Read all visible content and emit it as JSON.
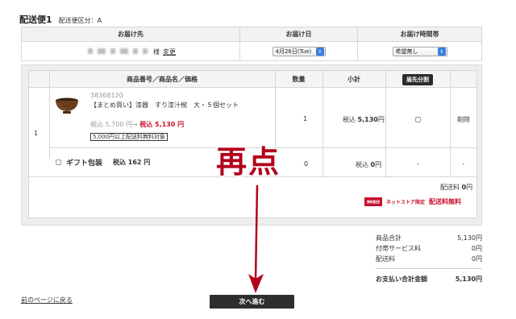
{
  "heading": {
    "title": "配送便1",
    "subtitle": "配送便区分：A"
  },
  "address_table": {
    "col_recipient": "お届け先",
    "col_date": "お届け日",
    "col_time": "お届け時間帯",
    "honorific": "様",
    "change_link": "変更",
    "date_value": "4月26日(Tue)",
    "time_value": "希望無し"
  },
  "items_table": {
    "col_product": "商品番号／商品名／価格",
    "col_qty": "数量",
    "col_subtotal": "小計",
    "split_button": "届先分割",
    "row_number": "1",
    "product": {
      "code": "38368120",
      "name": "【まとめ買い】漆器　すり漆汁椀　大・５個セット",
      "orig_price": "税込 5,700 円→",
      "sale_price": "税込 5,130 円",
      "free_shipping_badge": "5,000円以上配送料無料対象",
      "quantity": "1",
      "subtotal_prefix": "税込",
      "subtotal_value": "5,130",
      "subtotal_unit": "円",
      "delete_link": "削除"
    },
    "gift": {
      "label": "ギフト包装",
      "price": "税込 162 円",
      "quantity": "0",
      "subtotal_prefix": "税込",
      "subtotal_value": "0",
      "subtotal_unit": "円",
      "dash1": "-",
      "dash2": "-"
    },
    "shipping_label": "配送料",
    "shipping_value": "0",
    "shipping_unit": "円",
    "truck_icon_text": "無料配送",
    "netstore_label": "ネットストア限定",
    "free_shipping_label": "配送料無料"
  },
  "overlay": {
    "text": "再点"
  },
  "summary": {
    "rows": [
      {
        "label": "商品合計",
        "value": "5,130円"
      },
      {
        "label": "付帯サービス料",
        "value": "0円"
      },
      {
        "label": "配送料",
        "value": "0円"
      }
    ],
    "total_label": "お支払い合計金額",
    "total_value": "5,130円"
  },
  "nav": {
    "back_link": "前のページに戻る",
    "next_button": "次へ進む"
  },
  "colors": {
    "accent_red": "#c8102e",
    "select_blue": "#3a7de0",
    "button_dark": "#2e2e2e"
  }
}
